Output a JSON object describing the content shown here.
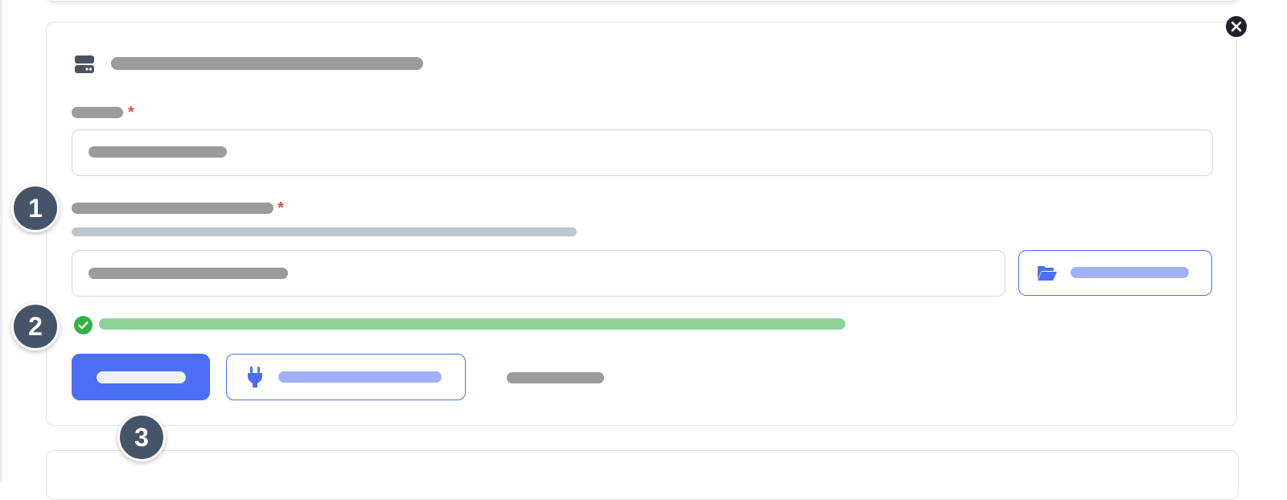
{
  "dialog": {
    "close_icon": "close-icon",
    "header_icon": "server-icon",
    "title": ""
  },
  "form": {
    "field_one": {
      "label": "",
      "required_mark": "*",
      "value": ""
    },
    "field_two": {
      "label": "",
      "required_mark": "*",
      "help_text": "",
      "value": ""
    },
    "browse_button": {
      "icon": "folder-open-icon",
      "label": ""
    },
    "status": {
      "icon": "check-circle-icon",
      "text": "",
      "color": "#2fb344"
    }
  },
  "actions": {
    "primary_label": "",
    "test_button": {
      "icon": "plug-icon",
      "label": ""
    },
    "link_label": ""
  },
  "markers": [
    "1",
    "2",
    "3"
  ],
  "colors": {
    "accent": "#4b6ef5",
    "marker": "#455468",
    "required": "#e5484d",
    "success": "#2fb344"
  }
}
